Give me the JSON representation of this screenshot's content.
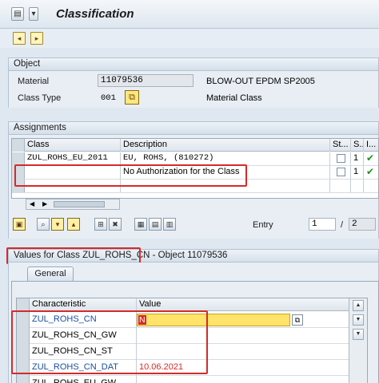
{
  "header": {
    "title": "Classification"
  },
  "object": {
    "section_title": "Object",
    "material_label": "Material",
    "material_value": "11079536",
    "material_desc": "BLOW-OUT EPDM SP2005",
    "class_type_label": "Class Type",
    "class_type_value": "001",
    "class_type_desc": "Material Class"
  },
  "assignments": {
    "section_title": "Assignments",
    "columns": [
      "Class",
      "Description",
      "St...",
      "S...",
      "I..."
    ],
    "rows": [
      {
        "class": "ZUL_ROHS_EU_2011",
        "description": "EU, ROHS, (810272)",
        "s": "1"
      },
      {
        "class": "",
        "description": "No Authorization for the Class",
        "s": "1"
      }
    ],
    "entry_label": "Entry",
    "entry_value": "1",
    "entry_sep": "/",
    "entry_total": "2"
  },
  "values": {
    "section_title_part1": "Values for Class ZUL_ROHS_CN",
    "section_title_part2": "- Object 11079536",
    "tab_general": "General",
    "columns": [
      "Characteristic",
      "Value"
    ],
    "rows": [
      {
        "name": "ZUL_ROHS_CN",
        "value": "N"
      },
      {
        "name": "ZUL_ROHS_CN_GW",
        "value": ""
      },
      {
        "name": "ZUL_ROHS_CN_ST",
        "value": ""
      },
      {
        "name": "ZUL_ROHS_CN_DAT",
        "value": "10.06.2021"
      },
      {
        "name": "ZUL_ROHS_EU_GW",
        "value": ""
      }
    ]
  },
  "colors": {
    "highlight_red": "#d52a2a",
    "link_blue": "#1a4fa0",
    "input_yellow": "#ffe36a",
    "tick_green": "#1f8f1f"
  }
}
